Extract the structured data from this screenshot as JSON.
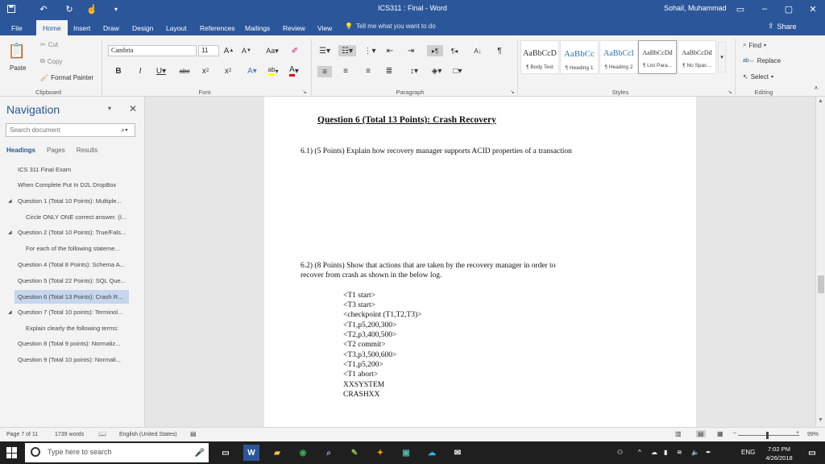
{
  "titlebar": {
    "doc_title": "ICS311 : Final  -  Word",
    "user": "Sohail, Muhammad",
    "save_icon": "save-icon",
    "undo_icon": "undo-icon",
    "redo_icon": "redo-icon"
  },
  "tabs": [
    "File",
    "Home",
    "Insert",
    "Draw",
    "Design",
    "Layout",
    "References",
    "Mailings",
    "Review",
    "View"
  ],
  "tellme": "Tell me what you want to do",
  "share": "Share",
  "ribbon": {
    "clipboard": {
      "paste": "Paste",
      "cut": "Cut",
      "copy": "Copy",
      "format_painter": "Format Painter",
      "label": "Clipboard"
    },
    "font": {
      "family": "Cambria",
      "size": "11",
      "label": "Font"
    },
    "paragraph": {
      "label": "Paragraph"
    },
    "styles": {
      "label": "Styles",
      "items": [
        {
          "sample": "AaBbCcD",
          "name": "¶ Body Text"
        },
        {
          "sample": "AaBbCc",
          "name": "¶ Heading 1"
        },
        {
          "sample": "AaBbCcI",
          "name": "¶ Heading 2"
        },
        {
          "sample": "AaBbCcDd",
          "name": "¶ List Para..."
        },
        {
          "sample": "AaBbCcDd",
          "name": "¶ No Spac..."
        }
      ]
    },
    "editing": {
      "find": "Find",
      "replace": "Replace",
      "select": "Select",
      "label": "Editing"
    }
  },
  "nav": {
    "title": "Navigation",
    "search_placeholder": "Search document",
    "tabs": [
      "Headings",
      "Pages",
      "Results"
    ],
    "items": [
      "ICS 311 Final Exam",
      "When Complete Put In D2L DropBox",
      "Question 1 (Total 10 Points): Multiple...",
      "Circle ONLY ONE correct answer. (I...",
      "Question 2 (Total 10 Points): True/Fals...",
      "For each of the following stateme...",
      "Question 4 (Total 8 Points): Schema A...",
      "Question 5 (Total 22 Points): SQL Que...",
      "Question 6 (Total 13 Points): Crash R...",
      "Question 7 (Total 10 points): Terminol...",
      "Explain clearly the following terms:",
      "Question 8 (Total 9 points): Normaliz...",
      "Question 9 (Total 10 points): Normali..."
    ]
  },
  "document": {
    "heading": "Question 6 (Total 13 Points):  Crash Recovery",
    "q61": "6.1)  (5 Points) Explain how recovery manager supports ACID properties of a transaction",
    "q62_line1": "6.2) (8 Points) Show that actions that are taken by the recovery manager in order to",
    "q62_line2": "recover  from crash as shown in the below log.",
    "log": [
      "<T1 start>",
      "<T3 start>",
      "<checkpoint (T1,T2,T3)>",
      "<T1,p5,200,300>",
      "<T2,p3,400,500>",
      "<T2 commit>",
      "<T3,p3,500,600>",
      "<T1,p5,200>",
      "<T1 abort>",
      "XXSYSTEM",
      "CRASHXX"
    ]
  },
  "status": {
    "page": "Page 7 of 11",
    "words": "1739 words",
    "language": "English (United States)",
    "zoom": "99%"
  },
  "taskbar": {
    "search_placeholder": "Type here to search",
    "lang": "ENG",
    "time": "7:02 PM",
    "date": "4/26/2018"
  }
}
